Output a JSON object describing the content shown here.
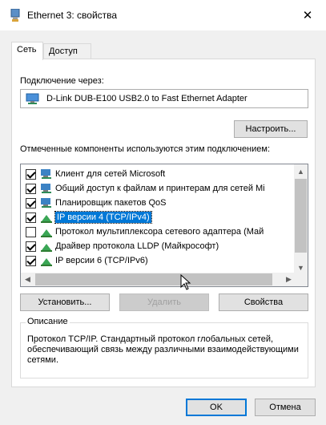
{
  "window": {
    "title": "Ethernet 3: свойства",
    "close_glyph": "✕"
  },
  "tabs": [
    {
      "label": "Сеть",
      "active": true
    },
    {
      "label": "Доступ",
      "active": false
    }
  ],
  "connection": {
    "label": "Подключение через:",
    "adapter": "D-Link DUB-E100 USB2.0 to Fast Ethernet Adapter",
    "configure_button": "Настроить..."
  },
  "components": {
    "label": "Отмеченные компоненты используются этим подключением:",
    "items": [
      {
        "label": "Клиент для сетей Microsoft",
        "checked": true,
        "icon": "network-client-icon",
        "selected": false
      },
      {
        "label": "Общий доступ к файлам и принтерам для сетей Mi",
        "checked": true,
        "icon": "network-service-icon",
        "selected": false
      },
      {
        "label": "Планировщик пакетов QoS",
        "checked": true,
        "icon": "network-service-icon",
        "selected": false
      },
      {
        "label": "IP версии 4 (TCP/IPv4)",
        "checked": true,
        "icon": "protocol-icon",
        "selected": true
      },
      {
        "label": "Протокол мультиплексора сетевого адаптера (Май",
        "checked": false,
        "icon": "protocol-icon",
        "selected": false
      },
      {
        "label": "Драйвер протокола LLDP (Майкрософт)",
        "checked": true,
        "icon": "protocol-icon",
        "selected": false
      },
      {
        "label": "IP версии 6 (TCP/IPv6)",
        "checked": true,
        "icon": "protocol-icon",
        "selected": false
      }
    ]
  },
  "actions": {
    "install": "Установить...",
    "remove": "Удалить",
    "properties": "Свойства"
  },
  "description": {
    "legend": "Описание",
    "text": "Протокол TCP/IP. Стандартный протокол глобальных сетей, обеспечивающий связь между различными взаимодействующими сетями."
  },
  "footer": {
    "ok": "OK",
    "cancel": "Отмена"
  },
  "colors": {
    "selection": "#0078d7",
    "focus_border": "#0078d7",
    "panel_border": "#d9d9d9"
  }
}
